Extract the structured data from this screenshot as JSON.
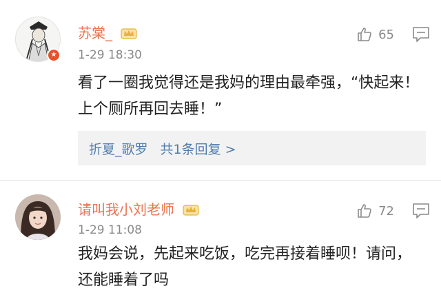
{
  "comments": [
    {
      "username": "苏棠_",
      "timestamp": "1-29 18:30",
      "likes": "65",
      "text": "看了一圈我觉得还是我妈的理由最牵强，“快起来！上个厕所再回去睡！”",
      "replies": {
        "user": "折夏_歌罗",
        "summary": "共1条回复 >"
      },
      "avatar_icon": "ink-portrait-avatar",
      "badge_icon": "verified-badge-icon"
    },
    {
      "username": "请叫我小刘老师",
      "timestamp": "1-29 11:08",
      "likes": "72",
      "text": "我妈会说，先起来吃饭，吃完再接着睡呗！请问，还能睡着了吗",
      "avatar_icon": "photo-avatar"
    }
  ],
  "colors": {
    "username": "#eb7350",
    "reply_link": "#507daf",
    "meta": "#8a8a8a",
    "crown_gold": "#e8b33a",
    "badge": "#e8502b"
  }
}
